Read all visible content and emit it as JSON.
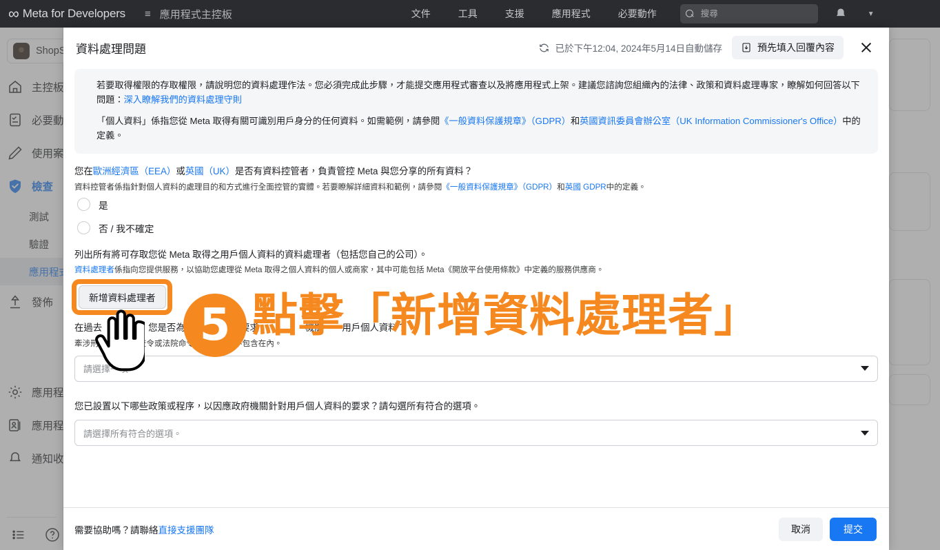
{
  "topnav": {
    "brand_logo_icon": "meta-infinity-logo",
    "brand": "Meta for Developers",
    "hamburger_icon": "hamburger-menu-icon",
    "dashboard_label": "應用程式主控板",
    "links": [
      {
        "label": "文件"
      },
      {
        "label": "工具"
      },
      {
        "label": "支援"
      },
      {
        "label": "應用程式"
      },
      {
        "label": "必要動作"
      }
    ],
    "search": {
      "icon": "search-icon",
      "placeholder": "搜尋",
      "value": ""
    },
    "bell_icon": "notification-bell-icon",
    "caret_icon": "chevron-down-icon"
  },
  "sidebar": {
    "app_chip": {
      "avatar_icon": "app-avatar-icon",
      "name": "ShopSto"
    },
    "items": [
      {
        "label": "主控板",
        "icon": "home-icon"
      },
      {
        "label": "必要動",
        "icon": "checklist-icon"
      },
      {
        "label": "使用案",
        "icon": "pencil-icon"
      },
      {
        "label": "檢查",
        "icon": "shield-check-icon"
      }
    ],
    "sub_items": [
      {
        "label": "測試"
      },
      {
        "label": "驗證"
      },
      {
        "label": "應用程式"
      }
    ],
    "publish": {
      "label": "發佈",
      "icon": "upload-arrow-icon"
    },
    "bottom_items": [
      {
        "label": "應用程",
        "icon": "gear-icon"
      },
      {
        "label": "應用程",
        "icon": "app-roles-icon"
      },
      {
        "label": "通知收",
        "icon": "bell-icon"
      }
    ],
    "footer_icons": [
      {
        "icon": "list-icon"
      },
      {
        "icon": "help-question-icon"
      }
    ]
  },
  "modal": {
    "title": "資料處理問題",
    "autosave": {
      "icon": "refresh-icon",
      "text": "已於下午12:04, 2024年5月14日自動儲存"
    },
    "prefill_button": {
      "icon": "prefill-download-icon",
      "label": "預先填入回覆內容"
    },
    "close_icon": "close-icon",
    "notice": {
      "p1_before": "若要取得權限的存取權限，請說明您的資料處理作法。您必須完成此步驟，才能提交應用程式審查以及將應用程式上架。建議您諮詢您組織內的法律、政策和資料處理專家，瞭解如何回答以下問題：",
      "p1_link": "深入瞭解我們的資料處理守則",
      "p2_a": "「個人資料」係指您從 Meta 取得有關可識別用戶身分的任何資料。如需範例，請參閱",
      "p2_link1": "《一般資料保護規章》（GDPR）",
      "p2_b": "和",
      "p2_link2": "英國資訊委員會辦公室（UK Information Commissioner's Office）",
      "p2_c": "中的定義。"
    },
    "q1": {
      "main_a": "您在",
      "main_link1": "歐洲經濟區（EEA）",
      "main_b": "或",
      "main_link2": "英國（UK）",
      "main_c": "是否有資料控管者，負責管控 Meta 與您分享的所有資料？",
      "sub_a": "資料控管者係指針對個人資料的處理目的和方式進行全面控管的實體。若要瞭解詳細資料和範例，請參閱",
      "sub_link1": "《一般資料保護規章》（GDPR）",
      "sub_b": "和",
      "sub_link2": "英國 GDPR",
      "sub_c": "中的定義。",
      "options": [
        {
          "label": "是",
          "selected": false
        },
        {
          "label": "否 / 我不確定",
          "selected": false
        }
      ]
    },
    "q2": {
      "main": "列出所有將可存取您從 Meta 取得之用戶個人資料的資料處理者（包括您自己的公司）。",
      "sub_link": "資料處理者",
      "sub_text": "係指向您提供服務，以協助您處理從 Meta 取得之個人資料的個人或商家，其中可能包括 Meta《開放平台使用條款》中定義的服務供應商。",
      "add_button": "新增資料處理者"
    },
    "q3": {
      "main": "在過去　　　內，您是否為　　　　安全要求　　　　　機關　　用戶個人資料？",
      "sub": "牽涉刑事　　　　查令或法院命令的相關要求不包含在內。",
      "select_placeholder": "請選擇一項。"
    },
    "q4": {
      "main": "您已設置以下哪些政策或程序，以因應政府機關針對用戶個人資料的要求？請勾選所有符合的選項。",
      "select_placeholder": "請選擇所有符合的選項。"
    },
    "footer": {
      "help_text": "需要協助嗎？請聯絡",
      "help_link": "直接支援團隊",
      "cancel_label": "取消",
      "submit_label": "提交"
    }
  },
  "annotation": {
    "step_number": "5",
    "text": "點擊「新增資料處理者」",
    "color": "#f5891f",
    "cursor_icon": "pointing-hand-cursor"
  },
  "colors": {
    "brand_blue": "#1877f2",
    "nav_dark": "#2b2c2f",
    "annotation_orange": "#f5891f",
    "page_bg": "#ffffff"
  }
}
